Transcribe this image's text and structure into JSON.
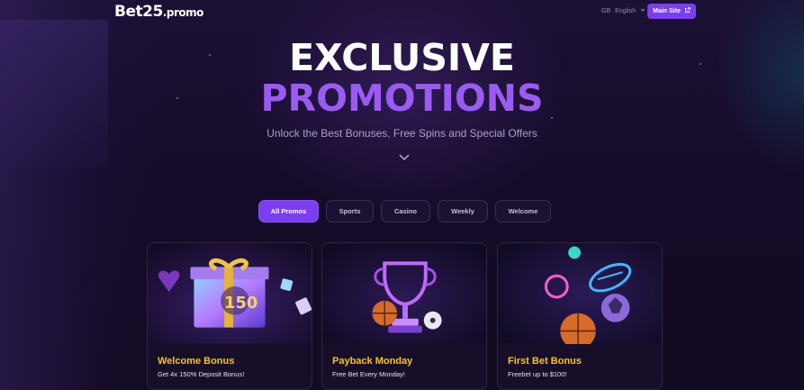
{
  "header": {
    "logo_main": "Bet",
    "logo_num": "25",
    "logo_domain": ".promo",
    "lang_code": "GB",
    "lang_label": "English",
    "main_site_label": "Main Site"
  },
  "hero": {
    "title_line1": "EXCLUSIVE",
    "title_line2": "PROMOTIONS",
    "subtitle": "Unlock the Best Bonuses, Free Spins and Special Offers"
  },
  "filters": [
    {
      "label": "All Promos",
      "active": true
    },
    {
      "label": "Sports",
      "active": false
    },
    {
      "label": "Casino",
      "active": false
    },
    {
      "label": "Weekly",
      "active": false
    },
    {
      "label": "Welcome",
      "active": false
    }
  ],
  "cards": [
    {
      "title": "Welcome Bonus",
      "desc": "Get 4x 150% Deposit Bonus!",
      "badge": "150"
    },
    {
      "title": "Payback Monday",
      "desc": "Free Bet Every Monday!"
    },
    {
      "title": "First Bet Bonus",
      "desc": "Freebet up to $100!"
    }
  ],
  "colors": {
    "accent": "#7a3ef0",
    "title_purple": "#9a5bf2",
    "card_title": "#f5c518",
    "background": "#140b24"
  }
}
